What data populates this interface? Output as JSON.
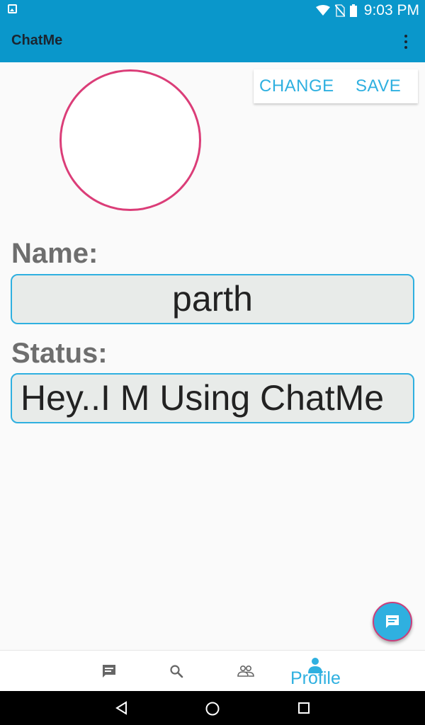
{
  "status_bar": {
    "time": "9:03 PM",
    "icons": [
      "image-notification-icon",
      "wifi-icon",
      "no-sim-icon",
      "battery-icon"
    ]
  },
  "app_bar": {
    "title": "ChatMe",
    "menu_icon": "overflow-menu-icon"
  },
  "profile": {
    "avatar_border_color": "#db3d78",
    "actions": {
      "change_label": "CHANGE",
      "save_label": "SAVE"
    },
    "name_label": "Name:",
    "name_value": "parth",
    "status_label": "Status:",
    "status_value": "Hey..I M Using ChatMe"
  },
  "fab": {
    "icon": "message-icon"
  },
  "bottom_nav": {
    "items": [
      {
        "icon": "chat-icon",
        "label": ""
      },
      {
        "icon": "search-icon",
        "label": ""
      },
      {
        "icon": "people-icon",
        "label": ""
      },
      {
        "icon": "person-icon",
        "label": "Profile",
        "active": true
      }
    ]
  },
  "system_nav": {
    "icons": [
      "back-icon",
      "home-icon",
      "recents-icon"
    ]
  },
  "colors": {
    "primary": "#0a97cb",
    "accent": "#2fb0e0",
    "pink_accent": "#db3d78",
    "label_gray": "#6e6e6e"
  }
}
